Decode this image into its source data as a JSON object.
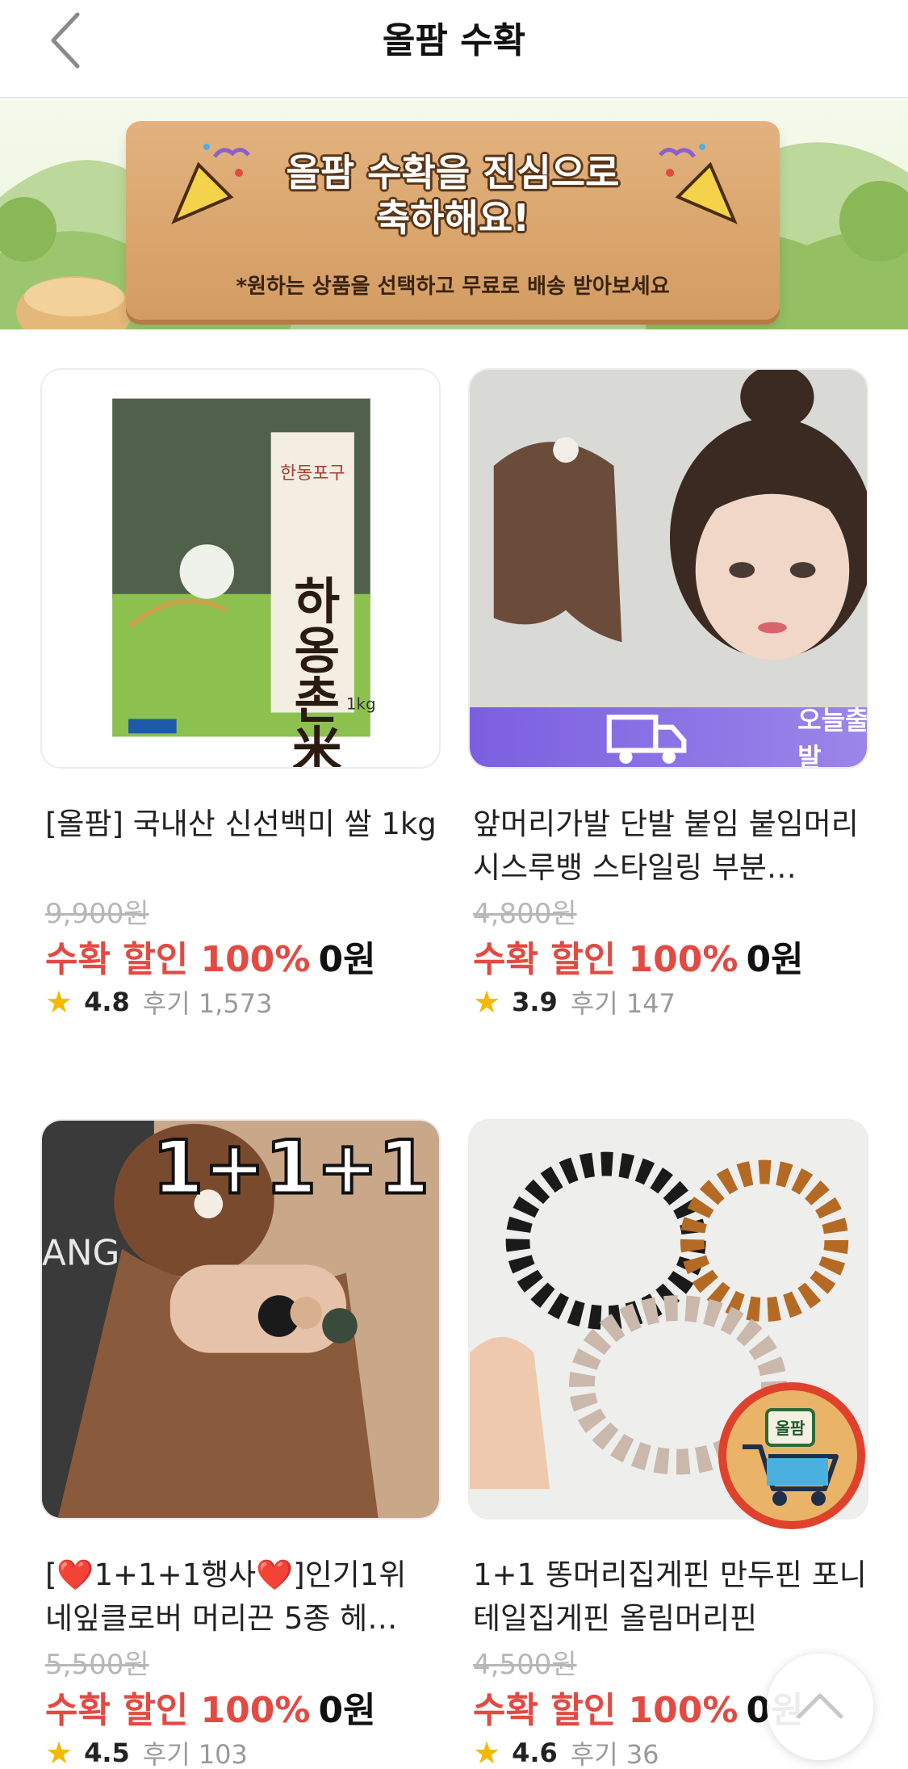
{
  "header": {
    "title": "올팜 수확"
  },
  "banner": {
    "title_line1": "올팜 수확을 진심으로",
    "title_line2": "축하해요!",
    "subtitle": "*원하는 상품을 선택하고 무료로 배송 받아보세요"
  },
  "products": [
    {
      "name": "[올팜] 국내산 신선백미 쌀 1kg",
      "original_price": "9,900원",
      "discount_label": "수확 할인 100%",
      "price": "0원",
      "rating": "4.8",
      "reviews": "후기 1,573",
      "package_text": "하옹촌米",
      "package_brand": "한동포구",
      "package_weight": "1kg"
    },
    {
      "name": "앞머리가발 단발 붙임 붙임머리 시스루뱅 스타일링 부분…",
      "original_price": "4,800원",
      "discount_label": "수확 할인 100%",
      "price": "0원",
      "rating": "3.9",
      "reviews": "후기 147",
      "badge": "오늘출발"
    },
    {
      "name": "[❤️1+1+1행사❤️]인기1위 네잎클로버 머리끈 5종 헤…",
      "original_price": "5,500원",
      "discount_label": "수확 할인 100%",
      "price": "0원",
      "rating": "4.5",
      "reviews": "후기 103",
      "image_text": "1+1+1",
      "image_bg_text": "ANG"
    },
    {
      "name": "1+1 똥머리집게핀 만두핀 포니테일집게핀 올림머리핀",
      "original_price": "4,500원",
      "discount_label": "수확 할인 100%",
      "price": "0원",
      "rating": "4.6",
      "reviews": "후기 36"
    }
  ],
  "cart_fab": {
    "label": "올팜",
    "icon": "cart-icon"
  },
  "scroll_top": {
    "icon": "chevron-up-icon"
  },
  "colors": {
    "discount": "#e34a42",
    "star": "#f5b800",
    "badge": "#7b5fe0",
    "fab_border": "#e0412d"
  }
}
